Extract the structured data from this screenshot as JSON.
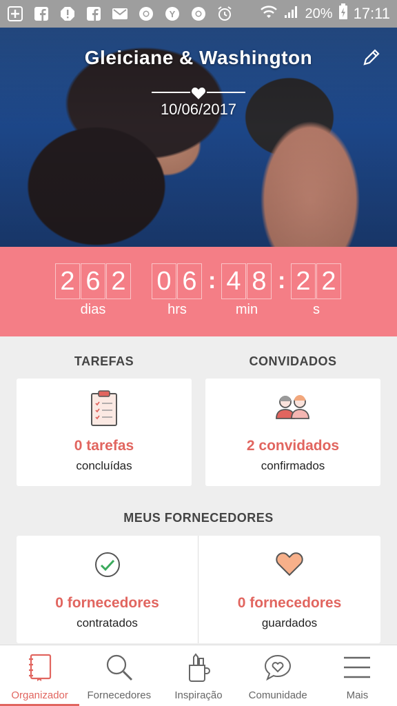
{
  "status_bar": {
    "battery": "20%",
    "time": "17:11"
  },
  "hero": {
    "couple": "Gleiciane & Washington",
    "date": "10/06/2017"
  },
  "countdown": {
    "days": [
      "2",
      "6",
      "2"
    ],
    "hours": [
      "0",
      "6"
    ],
    "minutes": [
      "4",
      "8"
    ],
    "seconds": [
      "2",
      "2"
    ],
    "labels": {
      "days": "dias",
      "hours": "hrs",
      "minutes": "min",
      "seconds": "s"
    }
  },
  "tasks": {
    "title": "TAREFAS",
    "value": "0 tarefas",
    "sub": "concluídas"
  },
  "guests": {
    "title": "CONVIDADOS",
    "value": "2 convidados",
    "sub": "confirmados"
  },
  "suppliers": {
    "title": "MEUS FORNECEDORES",
    "hired_value": "0 fornecedores",
    "hired_sub": "contratados",
    "saved_value": "0 fornecedores",
    "saved_sub": "guardados"
  },
  "nav": {
    "items": [
      {
        "label": "Organizador",
        "icon": "planner-icon",
        "active": true
      },
      {
        "label": "Fornecedores",
        "icon": "search-icon",
        "active": false
      },
      {
        "label": "Inspiração",
        "icon": "inspiration-icon",
        "active": false
      },
      {
        "label": "Comunidade",
        "icon": "chat-heart-icon",
        "active": false
      },
      {
        "label": "Mais",
        "icon": "menu-icon",
        "active": false
      }
    ]
  },
  "colors": {
    "accent": "#e1655f",
    "countdown_bg": "#f47e86",
    "status_bar": "#9e9e9e"
  }
}
